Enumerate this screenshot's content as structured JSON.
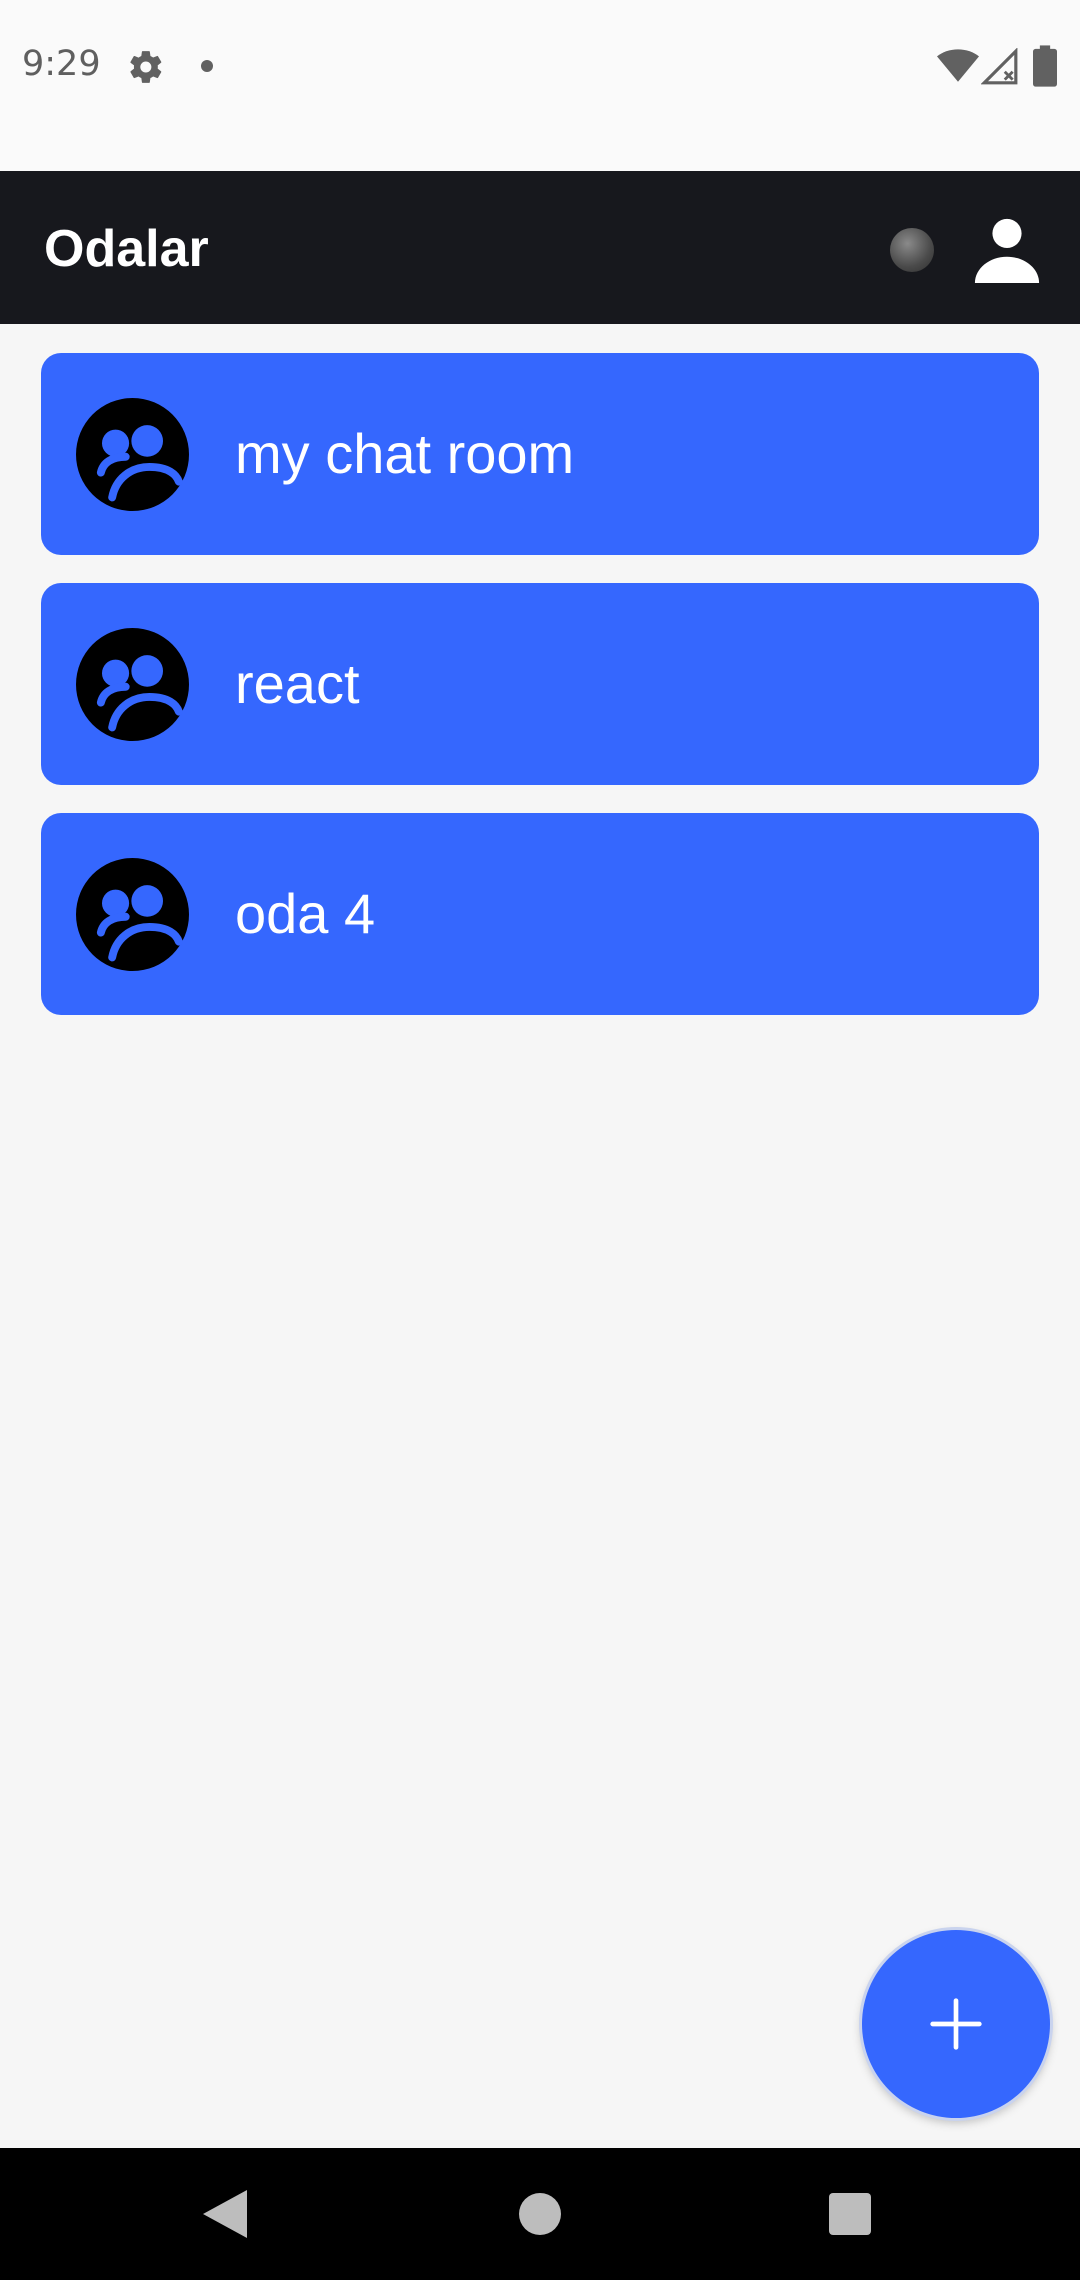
{
  "status_bar": {
    "time": "9:29",
    "icons": [
      "gear-icon",
      "notification-dot",
      "wifi-icon",
      "signal-icon",
      "battery-icon"
    ]
  },
  "app_bar": {
    "title": "Odalar",
    "background": "#17181d",
    "icons": [
      "connection-status-indicator",
      "account-icon"
    ]
  },
  "rooms": [
    {
      "name": "my chat room",
      "icon": "group-icon"
    },
    {
      "name": "react",
      "icon": "group-icon"
    },
    {
      "name": "oda 4",
      "icon": "group-icon"
    }
  ],
  "fab": {
    "icon": "plus-icon"
  },
  "nav_bar": {
    "icons": [
      "back-icon",
      "home-icon",
      "recents-icon"
    ]
  },
  "colors": {
    "accent": "#3567fe",
    "background": "#f6f6f6",
    "app_bar": "#17181d",
    "text_on_accent": "#ffffff"
  }
}
